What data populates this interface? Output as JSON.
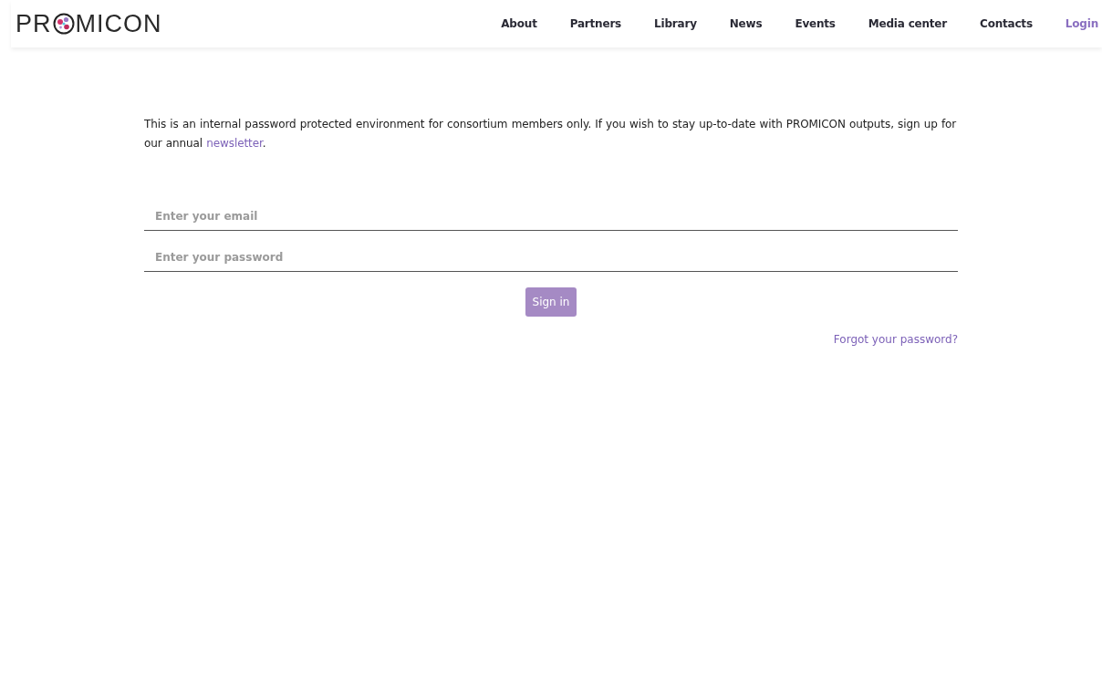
{
  "logo": {
    "text_before": "PR",
    "text_after": "MICON"
  },
  "nav": [
    {
      "label": "About",
      "kind": "link"
    },
    {
      "label": "Partners",
      "kind": "link"
    },
    {
      "label": "Library",
      "kind": "link"
    },
    {
      "label": "News",
      "kind": "link"
    },
    {
      "label": "Events",
      "kind": "link"
    },
    {
      "label": "Media center",
      "kind": "link"
    },
    {
      "label": "Contacts",
      "kind": "link"
    },
    {
      "label": "Login",
      "kind": "login"
    }
  ],
  "intro": {
    "text": "This is an internal password protected environment for consortium members only. If you wish to stay up-to-date with PROMICON outputs, sign up for our annual ",
    "link": "newsletter",
    "after": "."
  },
  "form": {
    "email": {
      "placeholder": "Enter your email"
    },
    "password": {
      "placeholder": "Enter your password"
    },
    "button": "Sign in",
    "forgot": "Forgot your password?"
  }
}
